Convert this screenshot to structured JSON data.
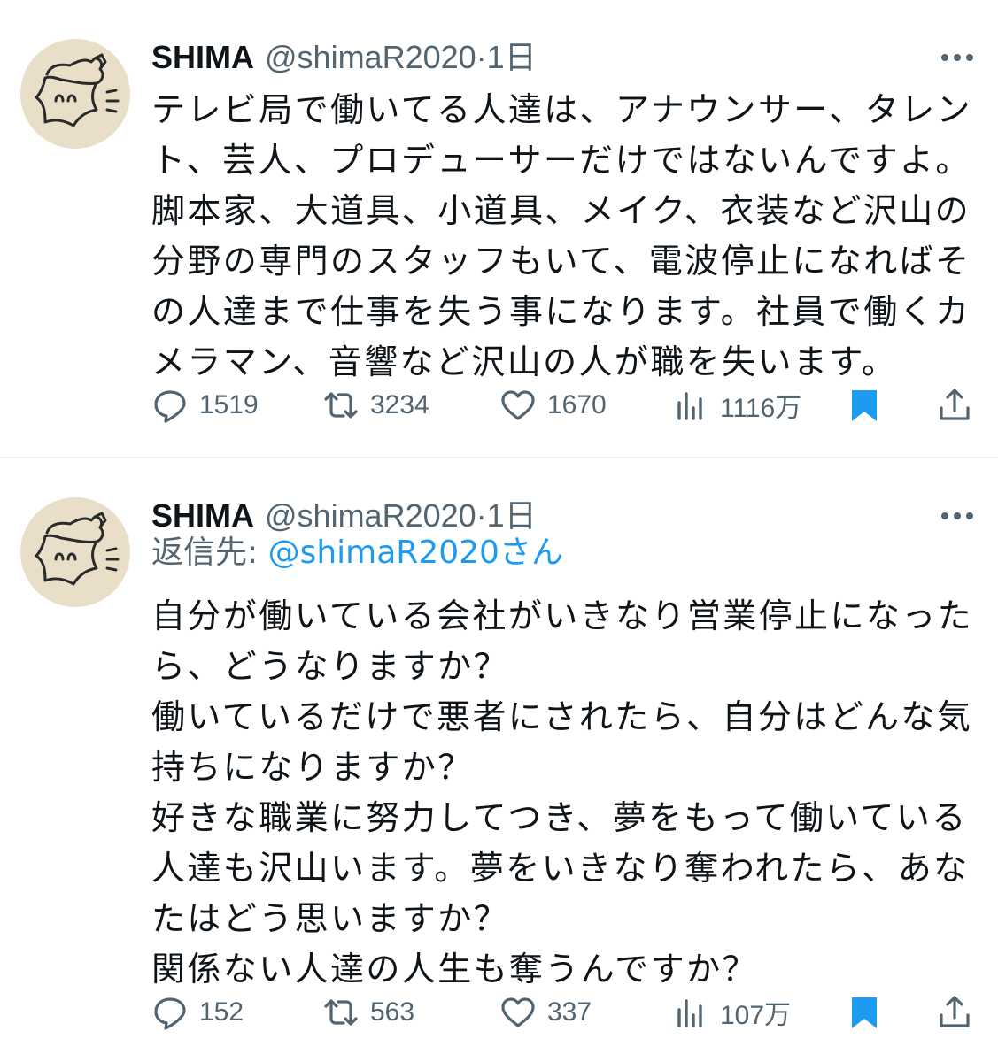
{
  "tweets": [
    {
      "author": {
        "name": "SHIMA",
        "handle": "@shimaR2020",
        "separator": "·",
        "time": "1日"
      },
      "reply_to": null,
      "text_lines": [
        "テレビ局で働いてる人達は、アナウンサー、タレン",
        "ト、芸人、プロデューサーだけではないんですよ。",
        "脚本家、大道具、小道具、メイク、衣装など沢山の",
        "分野の専門のスタッフもいて、電波停止になればそ",
        "の人達まで仕事を失う事になります。社員で働くカ",
        "メラマン、音響など沢山の人が職を失います。"
      ],
      "metrics": {
        "replies": "1519",
        "retweets": "3234",
        "likes": "1670",
        "views": "1116万"
      }
    },
    {
      "author": {
        "name": "SHIMA",
        "handle": "@shimaR2020",
        "separator": "·",
        "time": "1日"
      },
      "reply_to": {
        "prefix": "返信先:",
        "mention": "@shimaR2020",
        "suffix": "さん"
      },
      "text_lines": [
        "自分が働いている会社がいきなり営業停止になった",
        "ら、どうなりますか？",
        "働いているだけで悪者にされたら、自分はどんな気",
        "持ちになりますか？",
        "好きな職業に努力してつき、夢をもって働いている",
        "人達も沢山います。夢をいきなり奪われたら、あな",
        "たはどう思いますか？",
        "関係ない人達の人生も奪うんですか？"
      ],
      "metrics": {
        "replies": "152",
        "retweets": "563",
        "likes": "337",
        "views": "107万"
      }
    }
  ],
  "icons": {
    "more": "more-horizontal-icon",
    "reply": "reply-bubble-icon",
    "retweet": "retweet-arrows-icon",
    "like": "heart-icon",
    "views": "bar-chart-icon",
    "bookmark": "bookmark-filled-icon",
    "share": "share-upload-icon"
  },
  "colors": {
    "text": "#0f1419",
    "secondary": "#536471",
    "accent": "#1d9bf0",
    "divider": "#eff3f4",
    "avatar_bg": "#e9dfc8"
  }
}
